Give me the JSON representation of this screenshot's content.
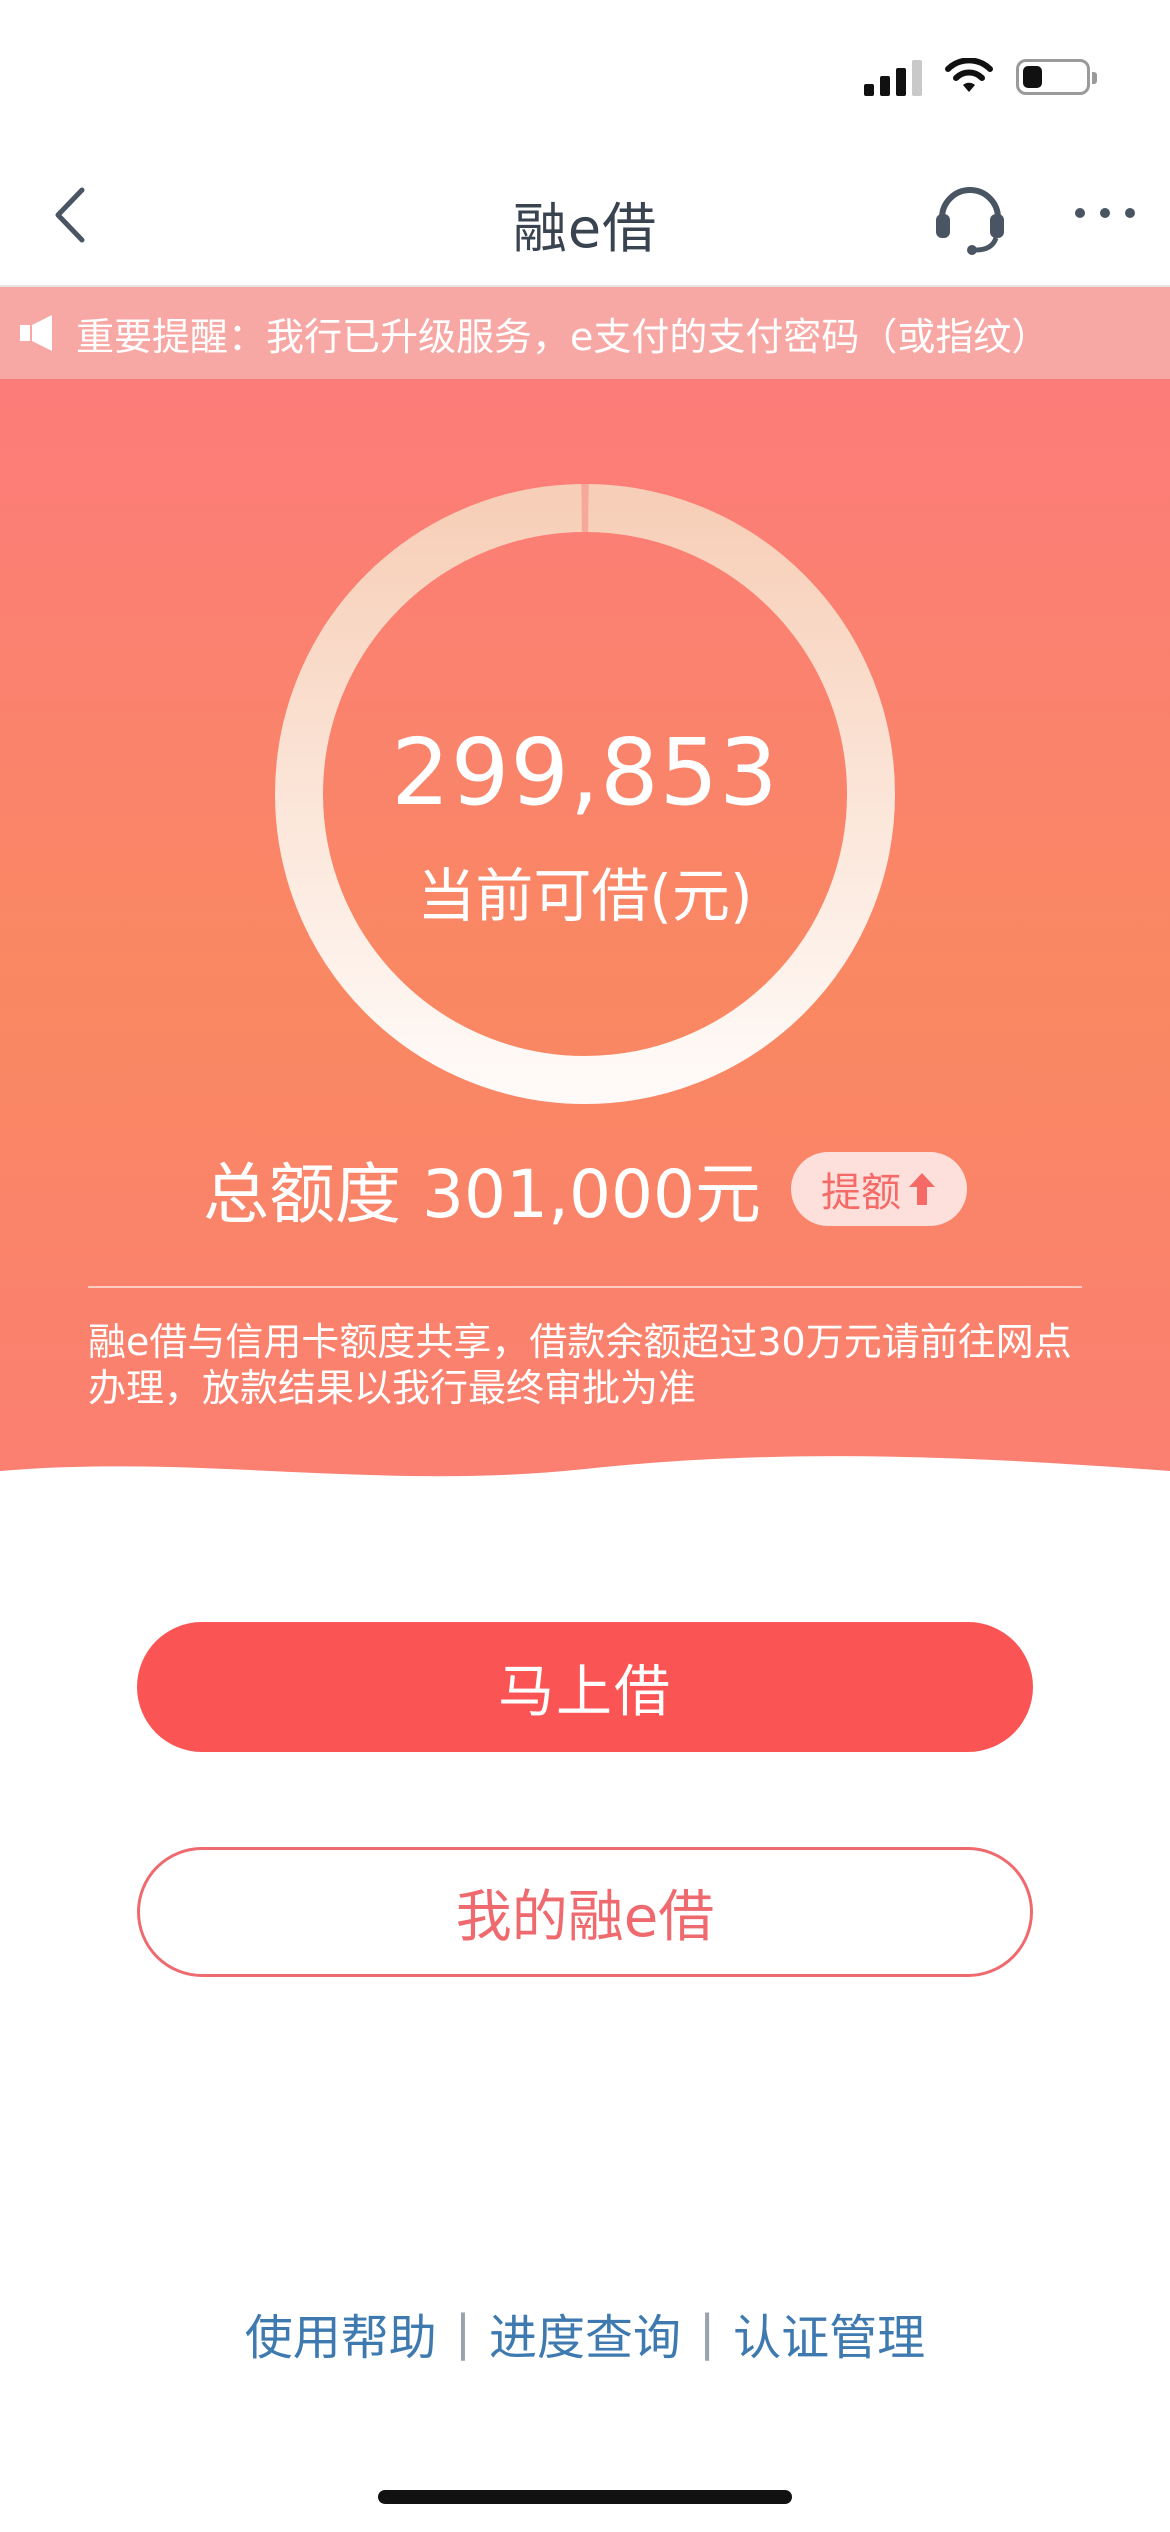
{
  "nav": {
    "title": "融e借",
    "back_icon": "chevron-left-icon",
    "headset_icon": "headset-icon",
    "more_icon": "more-dots-icon"
  },
  "status_bar": {
    "icons": [
      "signal-icon",
      "wifi-icon",
      "battery-icon"
    ],
    "battery_level": 0.3
  },
  "notice": {
    "icon": "speaker-icon",
    "text": "重要提醒：我行已升级服务，e支付的支付密码（或指纹）"
  },
  "credit": {
    "available_amount": "299,853",
    "available_label": "当前可借(元)",
    "total_text": "总额度 301,000元",
    "raise_label": "提额",
    "used_fraction": 0.0038,
    "note": "融e借与信用卡额度共享，借款余额超过30万元请前往网点办理，放款结果以我行最终审批为准"
  },
  "actions": {
    "borrow_label": "马上借",
    "my_loan_label": "我的融e借"
  },
  "footer": {
    "links": [
      "使用帮助",
      "进度查询",
      "认证管理"
    ],
    "separator": "|"
  },
  "colors": {
    "primary_red": "#fa5454",
    "hero_top": "#fc7c7a",
    "hero_mid": "#f98862",
    "link_blue": "#3e7ab0",
    "notice_bg": "#f8a8a4"
  }
}
